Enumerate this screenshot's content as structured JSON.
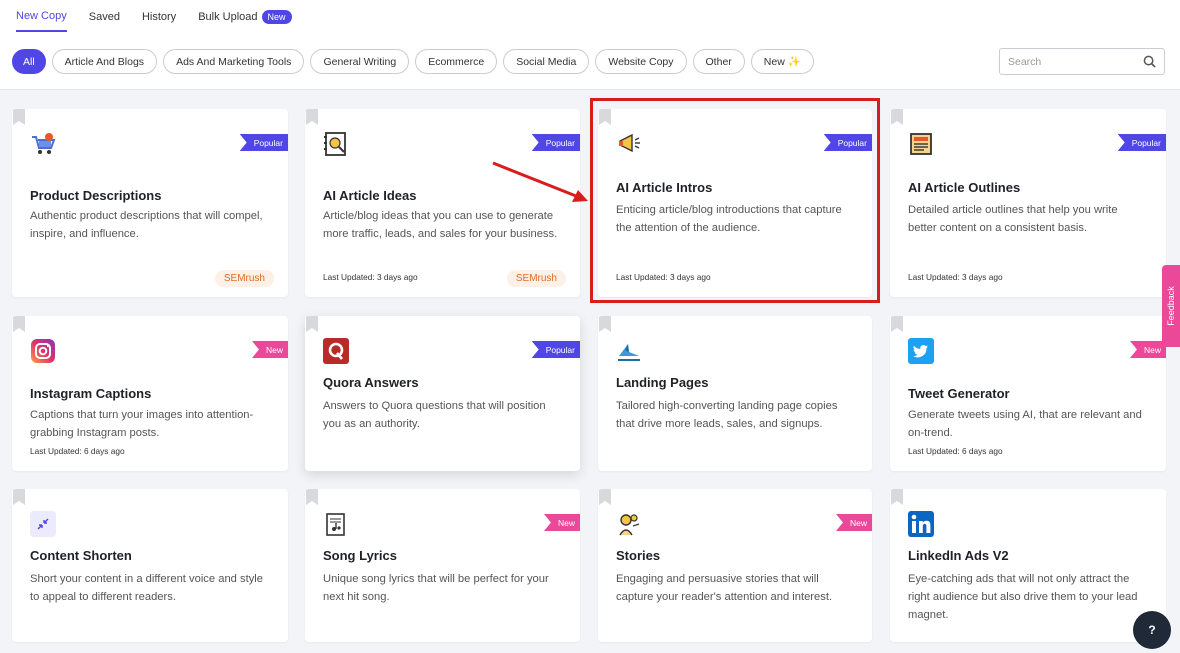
{
  "tabs": [
    {
      "label": "New Copy"
    },
    {
      "label": "Saved"
    },
    {
      "label": "History"
    },
    {
      "label": "Bulk Upload",
      "badge": "New"
    }
  ],
  "filters": [
    "All",
    "Article And Blogs",
    "Ads And Marketing Tools",
    "General Writing",
    "Ecommerce",
    "Social Media",
    "Website Copy",
    "Other",
    "New ✨"
  ],
  "search": {
    "placeholder": "Search"
  },
  "cards": [
    {
      "title": "Product Descriptions",
      "desc": "Authentic product descriptions that will compel, inspire, and influence.",
      "ribbon": "Popular",
      "updated": "",
      "tag": "SEMrush",
      "icon": "shopping-cart-icon"
    },
    {
      "title": "AI Article Ideas",
      "desc": "Article/blog ideas that you can use to generate more traffic, leads, and sales for your business.",
      "ribbon": "Popular",
      "updated": "Last Updated: 3 days ago",
      "tag": "SEMrush",
      "icon": "idea-notebook-icon"
    },
    {
      "title": "AI Article Intros",
      "desc": "Enticing article/blog introductions that capture the attention of the audience.",
      "ribbon": "Popular",
      "updated": "Last Updated: 3 days ago",
      "tag": "",
      "icon": "megaphone-icon"
    },
    {
      "title": "AI Article Outlines",
      "desc": "Detailed article outlines that help you write better content on a consistent basis.",
      "ribbon": "Popular",
      "updated": "Last Updated: 3 days ago",
      "tag": "",
      "icon": "newspaper-icon"
    },
    {
      "title": "Instagram Captions",
      "desc": "Captions that turn your images into attention-grabbing Instagram posts.",
      "ribbon": "New",
      "updated": "Last Updated: 6 days ago",
      "tag": "",
      "icon": "instagram-icon"
    },
    {
      "title": "Quora Answers",
      "desc": "Answers to Quora questions that will position you as an authority.",
      "ribbon": "Popular",
      "updated": "",
      "tag": "",
      "icon": "quora-icon"
    },
    {
      "title": "Landing Pages",
      "desc": "Tailored high-converting landing page copies that drive more leads, sales, and signups.",
      "ribbon": "",
      "updated": "",
      "tag": "",
      "icon": "landing-page-icon"
    },
    {
      "title": "Tweet Generator",
      "desc": "Generate tweets using AI, that are relevant and on-trend.",
      "ribbon": "New",
      "updated": "Last Updated: 6 days ago",
      "tag": "",
      "icon": "twitter-icon"
    },
    {
      "title": "Content Shorten",
      "desc": "Short your content in a different voice and style to appeal to different readers.",
      "ribbon": "",
      "updated": "",
      "tag": "",
      "icon": "shrink-icon"
    },
    {
      "title": "Song Lyrics",
      "desc": "Unique song lyrics that will be perfect for your next hit song.",
      "ribbon": "New",
      "updated": "",
      "tag": "",
      "icon": "music-sheet-icon"
    },
    {
      "title": "Stories",
      "desc": "Engaging and persuasive stories that will capture your reader's attention and interest.",
      "ribbon": "New",
      "updated": "",
      "tag": "",
      "icon": "storyteller-icon"
    },
    {
      "title": "LinkedIn Ads V2",
      "desc": "Eye-catching ads that will not only attract the right audience but also drive them to your lead magnet.",
      "ribbon": "",
      "updated": "",
      "tag": "",
      "icon": "linkedin-icon"
    }
  ],
  "feedback": "Feedback",
  "help": "?",
  "colors": {
    "accent": "#5046e5",
    "new": "#ec4899",
    "highlight": "#d91c1c"
  }
}
